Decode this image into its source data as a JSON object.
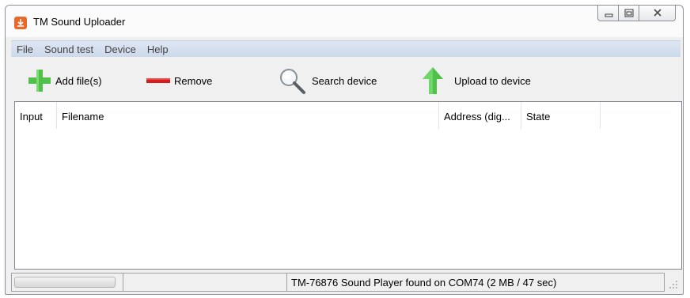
{
  "window": {
    "title": "TM Sound Uploader",
    "controls": [
      "minimize",
      "maximize",
      "close"
    ]
  },
  "menu": {
    "items": [
      "File",
      "Sound test",
      "Device",
      "Help"
    ]
  },
  "toolbar": {
    "add_label": "Add file(s)",
    "remove_label": "Remove",
    "search_label": "Search device",
    "upload_label": "Upload to device",
    "icons": {
      "add": "plus-icon",
      "remove": "minus-icon",
      "search": "magnifier-icon",
      "upload": "arrow-up-icon"
    }
  },
  "list": {
    "columns": [
      "Input",
      "Filename",
      "Address (dig...",
      "State"
    ],
    "rows": []
  },
  "status": {
    "progress": 0,
    "message": "TM-76876 Sound Player found on COM74 (2 MB / 47 sec)"
  },
  "colors": {
    "accent_green": "#4fc04a",
    "remove_red": "#d81b1b",
    "app_icon": "#e8692a",
    "menu_bg": "#d6e0ee"
  }
}
